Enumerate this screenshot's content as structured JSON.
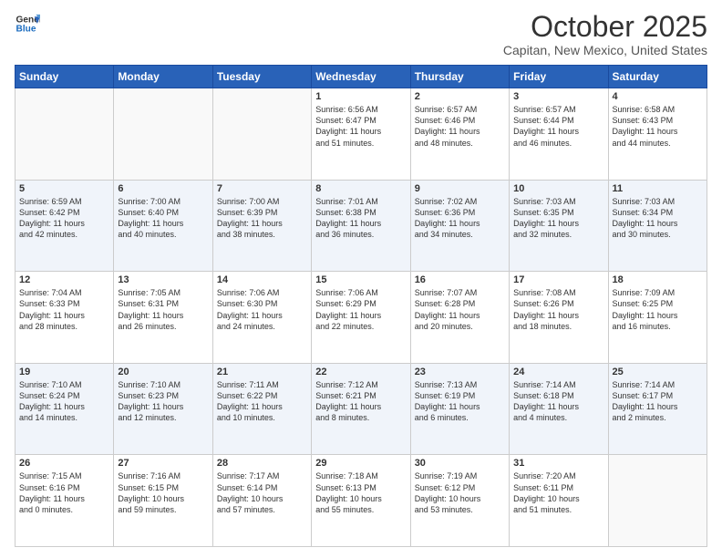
{
  "header": {
    "logo_line1": "General",
    "logo_line2": "Blue",
    "month": "October 2025",
    "location": "Capitan, New Mexico, United States"
  },
  "weekdays": [
    "Sunday",
    "Monday",
    "Tuesday",
    "Wednesday",
    "Thursday",
    "Friday",
    "Saturday"
  ],
  "weeks": [
    [
      {
        "day": "",
        "info": ""
      },
      {
        "day": "",
        "info": ""
      },
      {
        "day": "",
        "info": ""
      },
      {
        "day": "1",
        "info": "Sunrise: 6:56 AM\nSunset: 6:47 PM\nDaylight: 11 hours\nand 51 minutes."
      },
      {
        "day": "2",
        "info": "Sunrise: 6:57 AM\nSunset: 6:46 PM\nDaylight: 11 hours\nand 48 minutes."
      },
      {
        "day": "3",
        "info": "Sunrise: 6:57 AM\nSunset: 6:44 PM\nDaylight: 11 hours\nand 46 minutes."
      },
      {
        "day": "4",
        "info": "Sunrise: 6:58 AM\nSunset: 6:43 PM\nDaylight: 11 hours\nand 44 minutes."
      }
    ],
    [
      {
        "day": "5",
        "info": "Sunrise: 6:59 AM\nSunset: 6:42 PM\nDaylight: 11 hours\nand 42 minutes."
      },
      {
        "day": "6",
        "info": "Sunrise: 7:00 AM\nSunset: 6:40 PM\nDaylight: 11 hours\nand 40 minutes."
      },
      {
        "day": "7",
        "info": "Sunrise: 7:00 AM\nSunset: 6:39 PM\nDaylight: 11 hours\nand 38 minutes."
      },
      {
        "day": "8",
        "info": "Sunrise: 7:01 AM\nSunset: 6:38 PM\nDaylight: 11 hours\nand 36 minutes."
      },
      {
        "day": "9",
        "info": "Sunrise: 7:02 AM\nSunset: 6:36 PM\nDaylight: 11 hours\nand 34 minutes."
      },
      {
        "day": "10",
        "info": "Sunrise: 7:03 AM\nSunset: 6:35 PM\nDaylight: 11 hours\nand 32 minutes."
      },
      {
        "day": "11",
        "info": "Sunrise: 7:03 AM\nSunset: 6:34 PM\nDaylight: 11 hours\nand 30 minutes."
      }
    ],
    [
      {
        "day": "12",
        "info": "Sunrise: 7:04 AM\nSunset: 6:33 PM\nDaylight: 11 hours\nand 28 minutes."
      },
      {
        "day": "13",
        "info": "Sunrise: 7:05 AM\nSunset: 6:31 PM\nDaylight: 11 hours\nand 26 minutes."
      },
      {
        "day": "14",
        "info": "Sunrise: 7:06 AM\nSunset: 6:30 PM\nDaylight: 11 hours\nand 24 minutes."
      },
      {
        "day": "15",
        "info": "Sunrise: 7:06 AM\nSunset: 6:29 PM\nDaylight: 11 hours\nand 22 minutes."
      },
      {
        "day": "16",
        "info": "Sunrise: 7:07 AM\nSunset: 6:28 PM\nDaylight: 11 hours\nand 20 minutes."
      },
      {
        "day": "17",
        "info": "Sunrise: 7:08 AM\nSunset: 6:26 PM\nDaylight: 11 hours\nand 18 minutes."
      },
      {
        "day": "18",
        "info": "Sunrise: 7:09 AM\nSunset: 6:25 PM\nDaylight: 11 hours\nand 16 minutes."
      }
    ],
    [
      {
        "day": "19",
        "info": "Sunrise: 7:10 AM\nSunset: 6:24 PM\nDaylight: 11 hours\nand 14 minutes."
      },
      {
        "day": "20",
        "info": "Sunrise: 7:10 AM\nSunset: 6:23 PM\nDaylight: 11 hours\nand 12 minutes."
      },
      {
        "day": "21",
        "info": "Sunrise: 7:11 AM\nSunset: 6:22 PM\nDaylight: 11 hours\nand 10 minutes."
      },
      {
        "day": "22",
        "info": "Sunrise: 7:12 AM\nSunset: 6:21 PM\nDaylight: 11 hours\nand 8 minutes."
      },
      {
        "day": "23",
        "info": "Sunrise: 7:13 AM\nSunset: 6:19 PM\nDaylight: 11 hours\nand 6 minutes."
      },
      {
        "day": "24",
        "info": "Sunrise: 7:14 AM\nSunset: 6:18 PM\nDaylight: 11 hours\nand 4 minutes."
      },
      {
        "day": "25",
        "info": "Sunrise: 7:14 AM\nSunset: 6:17 PM\nDaylight: 11 hours\nand 2 minutes."
      }
    ],
    [
      {
        "day": "26",
        "info": "Sunrise: 7:15 AM\nSunset: 6:16 PM\nDaylight: 11 hours\nand 0 minutes."
      },
      {
        "day": "27",
        "info": "Sunrise: 7:16 AM\nSunset: 6:15 PM\nDaylight: 10 hours\nand 59 minutes."
      },
      {
        "day": "28",
        "info": "Sunrise: 7:17 AM\nSunset: 6:14 PM\nDaylight: 10 hours\nand 57 minutes."
      },
      {
        "day": "29",
        "info": "Sunrise: 7:18 AM\nSunset: 6:13 PM\nDaylight: 10 hours\nand 55 minutes."
      },
      {
        "day": "30",
        "info": "Sunrise: 7:19 AM\nSunset: 6:12 PM\nDaylight: 10 hours\nand 53 minutes."
      },
      {
        "day": "31",
        "info": "Sunrise: 7:20 AM\nSunset: 6:11 PM\nDaylight: 10 hours\nand 51 minutes."
      },
      {
        "day": "",
        "info": ""
      }
    ]
  ]
}
